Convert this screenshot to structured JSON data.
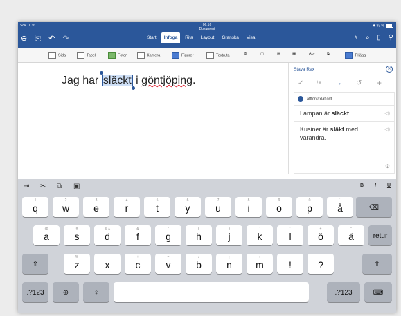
{
  "status": {
    "carrier": "Sök",
    "time": "06:16",
    "battery": "93 %"
  },
  "app": {
    "doc_title": "Dokument"
  },
  "tabs": [
    "Start",
    "Infoga",
    "Rita",
    "Layout",
    "Granska",
    "Visa"
  ],
  "active_tab": "Infoga",
  "ribbon": [
    "Sida",
    "Tabell",
    "Foton",
    "Kamera",
    "Figurer",
    "Textruta",
    "Tillägg"
  ],
  "document": {
    "before": "Jag har ",
    "selected": "släckt",
    "middle": " i ",
    "misspelled": "göntjöping",
    "after": "."
  },
  "panel": {
    "title": "Stava Rex",
    "category": "Lättförväxlat ord",
    "suggestions": [
      {
        "pre": "Lampan är ",
        "bold": "släckt",
        "post": "."
      },
      {
        "pre": "Kusiner är ",
        "bold": "släkt",
        "post": " med varandra."
      }
    ]
  },
  "keyboard": {
    "row1": [
      {
        "m": "q",
        "h": "1"
      },
      {
        "m": "w",
        "h": "2"
      },
      {
        "m": "e",
        "h": "3"
      },
      {
        "m": "r",
        "h": "4"
      },
      {
        "m": "t",
        "h": "5"
      },
      {
        "m": "y",
        "h": "6"
      },
      {
        "m": "u",
        "h": "7"
      },
      {
        "m": "i",
        "h": "8"
      },
      {
        "m": "o",
        "h": "9"
      },
      {
        "m": "p",
        "h": "0"
      },
      {
        "m": "å",
        "h": "´"
      }
    ],
    "row2": [
      {
        "m": "a",
        "h": "@"
      },
      {
        "m": "s",
        "h": "#"
      },
      {
        "m": "d",
        "h": "kr £"
      },
      {
        "m": "f",
        "h": "&"
      },
      {
        "m": "g",
        "h": "*"
      },
      {
        "m": "h",
        "h": "("
      },
      {
        "m": "j",
        "h": ")"
      },
      {
        "m": "k",
        "h": "'"
      },
      {
        "m": "l",
        "h": "\""
      },
      {
        "m": "ö",
        "h": "+"
      },
      {
        "m": "ä",
        "h": "*"
      }
    ],
    "row3": [
      {
        "m": "z",
        "h": "%"
      },
      {
        "m": "x",
        "h": "-"
      },
      {
        "m": "c",
        "h": "+"
      },
      {
        "m": "v",
        "h": "="
      },
      {
        "m": "b",
        "h": "/"
      },
      {
        "m": "n",
        "h": ";"
      },
      {
        "m": "m",
        "h": ":"
      },
      {
        "m": "!",
        "h": ""
      },
      {
        "m": "?",
        "h": ""
      }
    ],
    "return_label": "retur",
    "num_label": ".?123",
    "format": [
      "B",
      "I",
      "U"
    ]
  },
  "colors": {
    "accent": "#2b579a"
  }
}
